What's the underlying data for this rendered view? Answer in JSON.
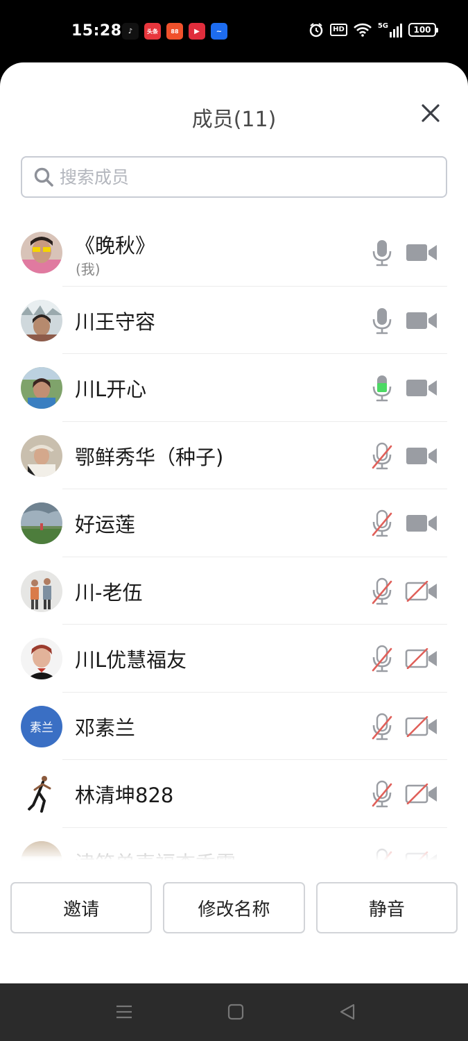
{
  "status_bar": {
    "time": "15:28",
    "app_icons": [
      {
        "name": "tiktok-icon",
        "glyph": "♪",
        "color": "#111111"
      },
      {
        "name": "toutiao-icon",
        "glyph": "头条",
        "color": "#e8363d"
      },
      {
        "name": "app-orange-icon",
        "glyph": "88",
        "color": "#f0512c"
      },
      {
        "name": "video-play-icon",
        "glyph": "▶",
        "color": "#e02d3c"
      },
      {
        "name": "app-blue-icon",
        "glyph": "~",
        "color": "#1d6cf0"
      }
    ],
    "hd": "HD",
    "network": "5G",
    "battery": "100"
  },
  "sheet": {
    "title": "成员(11)"
  },
  "search": {
    "placeholder": "搜索成员",
    "value": ""
  },
  "members": [
    {
      "name": "《晚秋》",
      "sub": "(我)",
      "mic": "on",
      "cam": "on",
      "avatar": "photo-yellow-glasses"
    },
    {
      "name": "川王守容",
      "mic": "on",
      "cam": "on",
      "avatar": "photo-snow"
    },
    {
      "name": "川L开心",
      "mic": "speaking",
      "cam": "on",
      "avatar": "photo-outdoor"
    },
    {
      "name": "鄂鲜秀华（种子)",
      "mic": "off",
      "cam": "on",
      "avatar": "photo-hat"
    },
    {
      "name": "好运莲",
      "mic": "off",
      "cam": "on",
      "avatar": "photo-field"
    },
    {
      "name": "川-老伍",
      "mic": "off",
      "cam": "off",
      "avatar": "photo-couple"
    },
    {
      "name": "川L优慧福友",
      "mic": "off",
      "cam": "off",
      "avatar": "photo-woman"
    },
    {
      "name": "邓素兰",
      "mic": "off",
      "cam": "off",
      "avatar_text": "素兰"
    },
    {
      "name": "林清坤828",
      "mic": "off",
      "cam": "off",
      "avatar": "photo-runner"
    },
    {
      "name": "津筑单壶福杏香露",
      "mic": "off",
      "cam": "off",
      "avatar": "photo-group"
    }
  ],
  "actions": {
    "invite": "邀请",
    "rename": "修改名称",
    "mute": "静音"
  },
  "colors": {
    "icon_gray": "#9a9da3",
    "mute_red": "#e0605a",
    "speaking_green": "#4cd964",
    "accent_blue": "#3a6fc4"
  }
}
